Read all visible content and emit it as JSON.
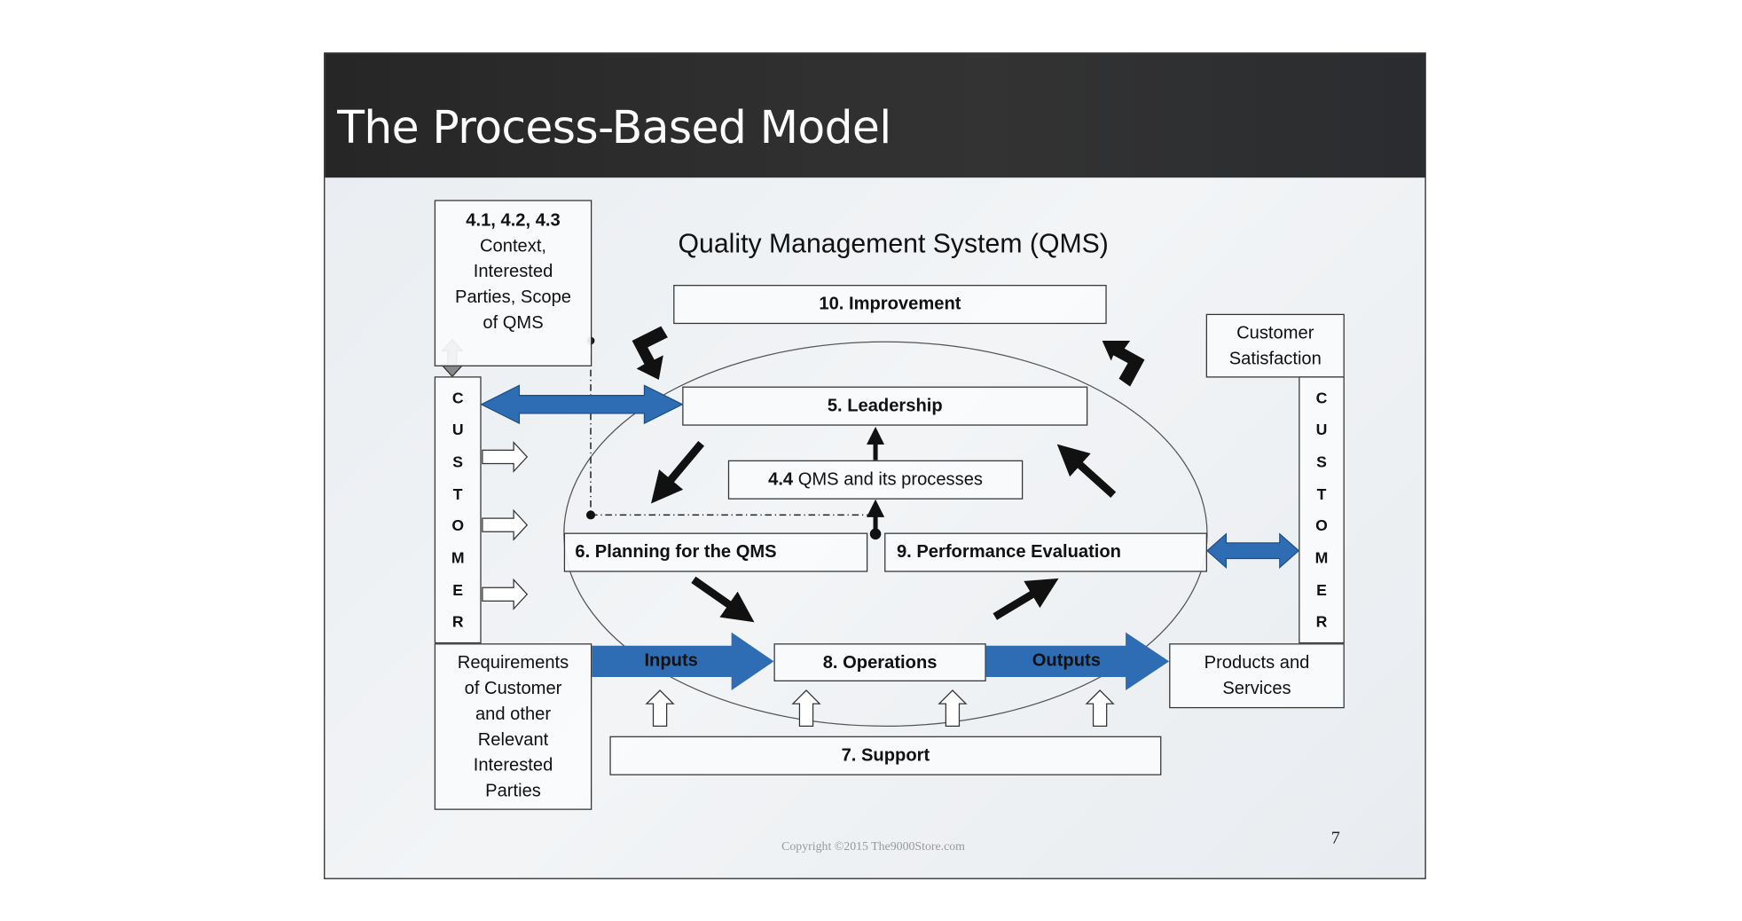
{
  "slide": {
    "title": "The Process-Based Model",
    "diagram_title": "Quality Management System (QMS)",
    "page_number": "7",
    "copyright": "Copyright ©2015 The9000Store.com"
  },
  "boxes": {
    "context": {
      "heading": "4.1, 4.2, 4.3",
      "lines": [
        "Context,",
        "Interested",
        "Parties, Scope",
        "of QMS"
      ]
    },
    "improvement": "10. Improvement",
    "customer_satisfaction": [
      "Customer",
      "Satisfaction"
    ],
    "leadership": "5. Leadership",
    "qms_processes": {
      "number": "4.4",
      "label": "QMS and its processes"
    },
    "planning": "6. Planning for the QMS",
    "performance": "9. Performance Evaluation",
    "operations": "8. Operations",
    "support": "7. Support",
    "requirements": [
      "Requirements",
      "of Customer",
      "and other",
      "Relevant",
      "Interested",
      "Parties"
    ],
    "products": [
      "Products and",
      "Services"
    ],
    "customer_left": [
      "C",
      "U",
      "S",
      "T",
      "O",
      "M",
      "E",
      "R"
    ],
    "customer_right": [
      "C",
      "U",
      "S",
      "T",
      "O",
      "M",
      "E",
      "R"
    ]
  },
  "arrows": {
    "inputs": "Inputs",
    "outputs": "Outputs"
  },
  "colors": {
    "blue_arrow": "#2e6db4",
    "header": "#2b2b2b",
    "black_arrow": "#111111"
  }
}
